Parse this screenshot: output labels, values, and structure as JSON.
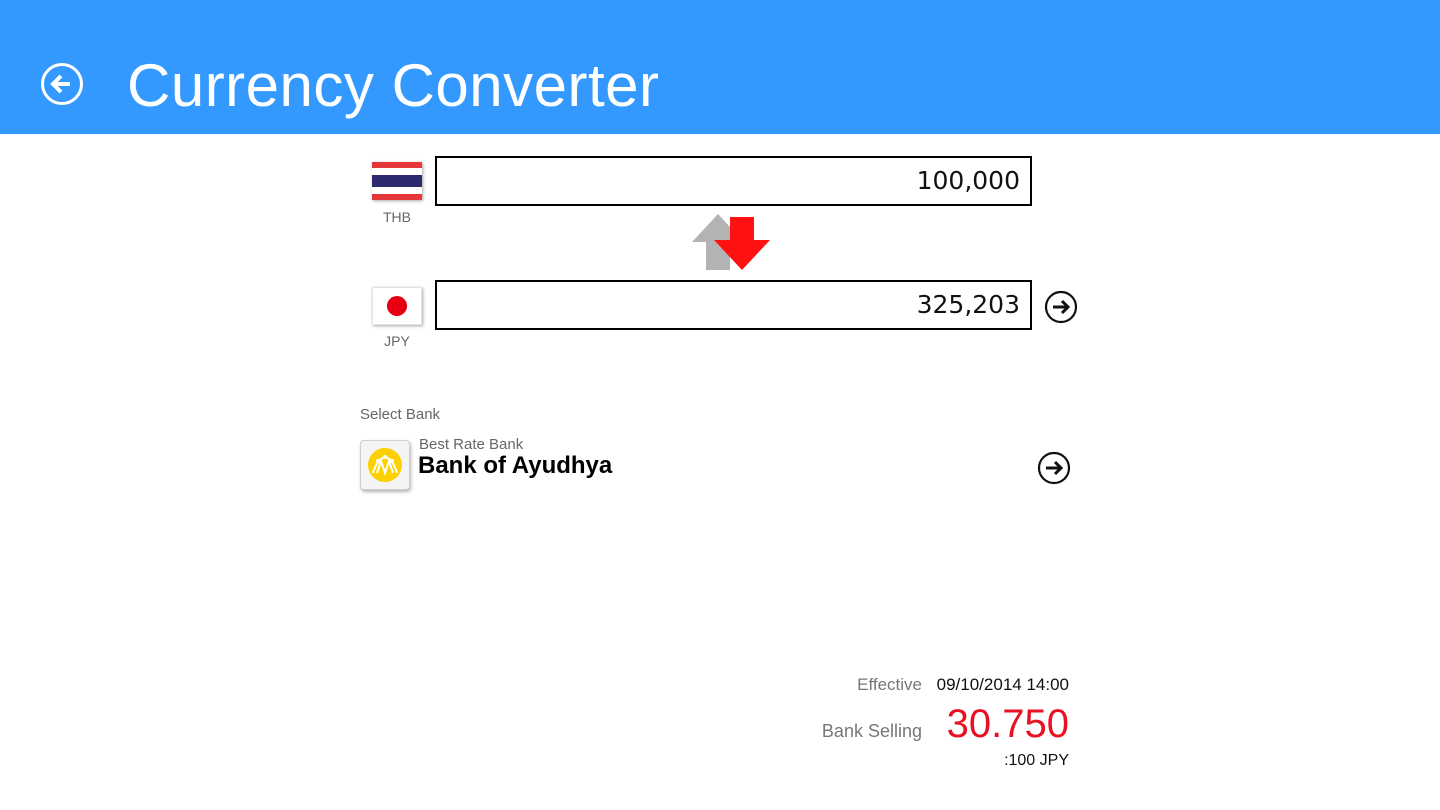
{
  "header": {
    "title": "Currency Converter",
    "back_icon": "back-arrow-circle-icon",
    "background_color": "#3399ff"
  },
  "converter": {
    "from": {
      "code": "THB",
      "amount": "100,000",
      "flag_icon": "thailand-flag-icon"
    },
    "to": {
      "code": "JPY",
      "amount": "325,203",
      "flag_icon": "japan-flag-icon"
    },
    "swap_icon": "swap-direction-arrows-icon",
    "active_direction": "down",
    "active_arrow_color": "#ff1111",
    "inactive_arrow_color": "#b3b3b3"
  },
  "bank": {
    "select_label": "Select Bank",
    "subtitle": "Best Rate Bank",
    "name": "Bank of Ayudhya",
    "logo_color": "#fdd000"
  },
  "rate": {
    "effective_label": "Effective",
    "effective_value": "09/10/2014 14:00",
    "selling_label": "Bank Selling",
    "selling_value": "30.750",
    "selling_color": "#e81123",
    "per_unit": ":100 JPY"
  }
}
